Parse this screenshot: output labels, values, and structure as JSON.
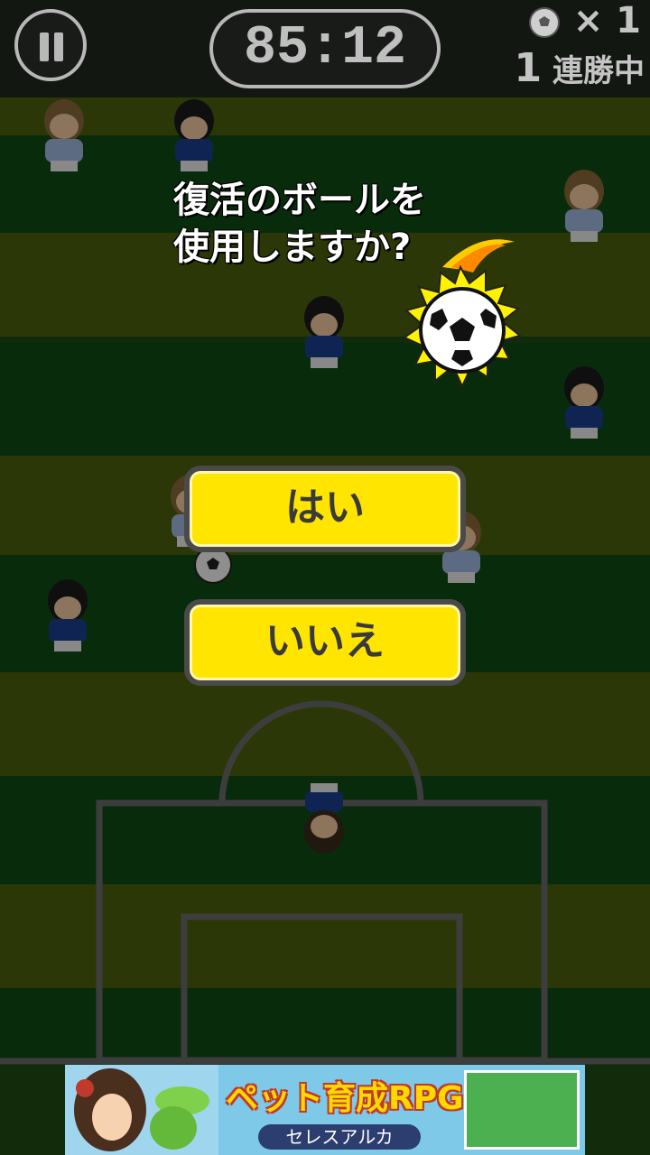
{
  "hud": {
    "timer": "85:12",
    "ball_count": "× 1",
    "streak_number": "1",
    "streak_label": "連勝中"
  },
  "dialog": {
    "question_line1": "復活のボールを",
    "question_line2": "使用しますか?",
    "yes_label": "はい",
    "no_label": "いいえ"
  },
  "ad": {
    "title": "ペット育成RPG",
    "subtitle": "セレスアルカ"
  },
  "icons": [
    "pause-icon",
    "soccer-ball-icon",
    "revival-ball-icon"
  ],
  "colors": {
    "button_fill": "#ffe500",
    "button_border": "#4a4a4a",
    "pitch_dark": "#0f4a13",
    "pitch_olive": "#4b5f0c",
    "team_blue": "#1c3f8f",
    "team_light": "#9fb8e0",
    "flame_yellow": "#fff200"
  }
}
